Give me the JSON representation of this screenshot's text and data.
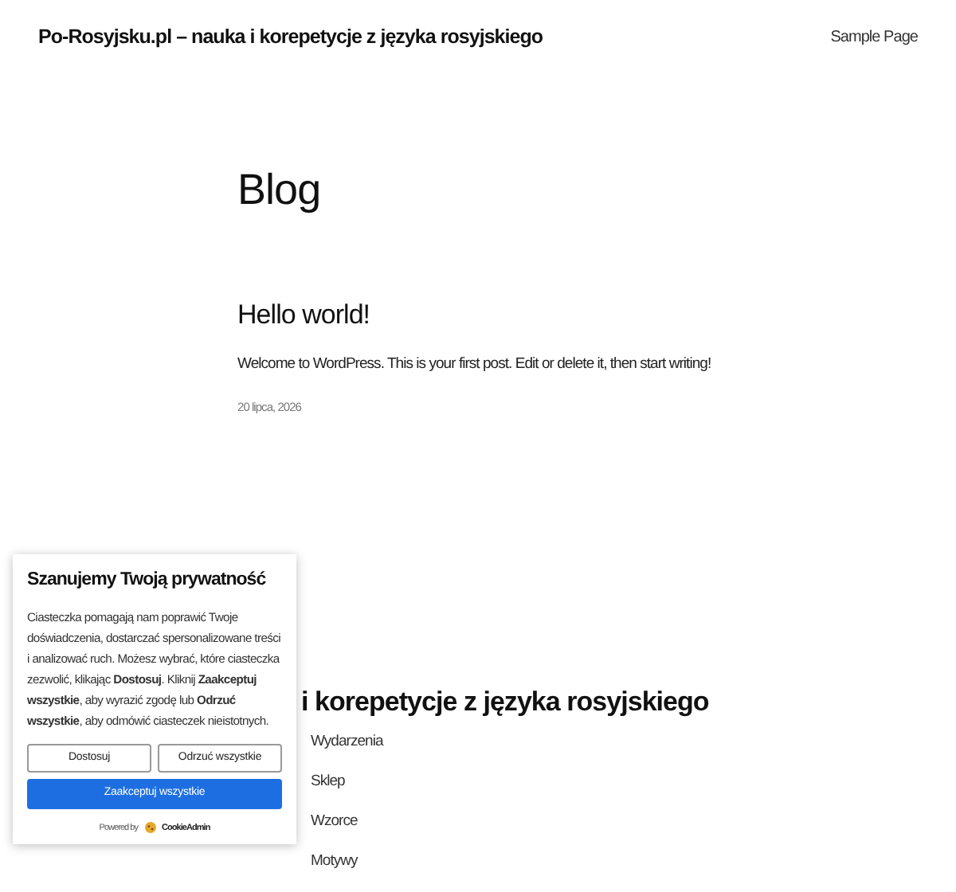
{
  "header": {
    "site_title": "Po-Rosyjsku.pl – nauka i korepetycje z języka rosyjskiego",
    "nav": [
      "Sample Page"
    ]
  },
  "page_title": "Blog",
  "posts": [
    {
      "title": "Hello world!",
      "excerpt": "Welcome to WordPress. This is your first post. Edit or delete it, then start writing!",
      "date": "20 lipca, 2026"
    }
  ],
  "footer": {
    "heading": "i korepetycje z języka rosyjskiego",
    "links": [
      "Wydarzenia",
      "Sklep",
      "Wzorce",
      "Motywy"
    ]
  },
  "cookie_banner": {
    "title": "Szanujemy Twoją prywatność",
    "text": "Ciasteczka pomagają nam poprawić Twoje doświadczenia, dostarczać spersonalizowane treści i analizować ruch. Możesz wybrać, które ciasteczka zezwolić, klikając **Dostosuj**. Kliknij **Zaakceptuj wszystkie**, aby wyrazić zgodę lub **Odrzuć wszystkie**, aby odmówić ciasteczek nieistotnych.",
    "buttons": [
      {
        "label": "Dostosuj",
        "kind": "outline"
      },
      {
        "label": "Odrzuć wszystkie",
        "kind": "outline"
      },
      {
        "label": "Zaakceptuj wszystkie",
        "kind": "primary"
      }
    ],
    "powered_by": "Powered by",
    "brand": "CookieAdmin"
  }
}
